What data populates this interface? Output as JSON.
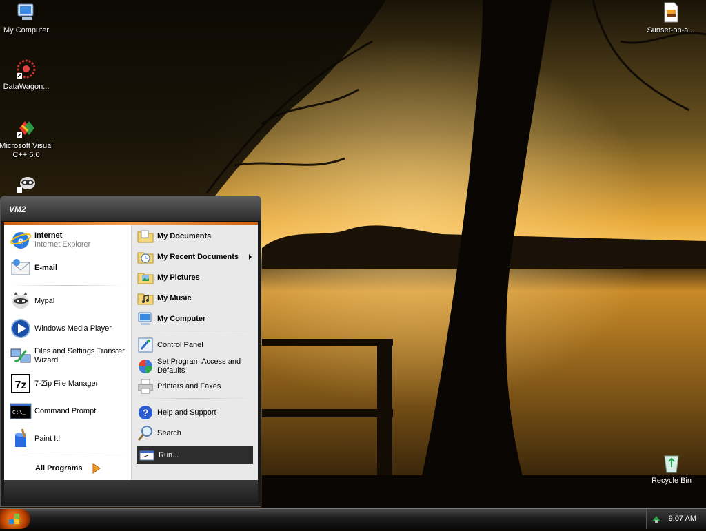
{
  "desktop": {
    "icons": [
      {
        "label": "My Computer"
      },
      {
        "label": "DataWagon..."
      },
      {
        "label": "Microsoft Visual C++ 6.0"
      },
      {
        "label": ""
      },
      {
        "label": "Sunset-on-a..."
      },
      {
        "label": "Recycle Bin"
      }
    ]
  },
  "start_menu": {
    "user": "VM2",
    "pinned": [
      {
        "title": "Internet",
        "subtitle": "Internet Explorer",
        "icon": "internet-explorer-icon"
      },
      {
        "title": "E-mail",
        "icon": "email-icon"
      }
    ],
    "recent": [
      {
        "label": "Mypal",
        "icon": "mypal-icon"
      },
      {
        "label": "Windows Media Player",
        "icon": "media-player-icon"
      },
      {
        "label": "Files and Settings Transfer Wizard",
        "icon": "transfer-wizard-icon"
      },
      {
        "label": "7-Zip File Manager",
        "icon": "7zip-icon"
      },
      {
        "label": "Command Prompt",
        "icon": "command-prompt-icon"
      },
      {
        "label": "Paint It!",
        "icon": "paint-icon"
      }
    ],
    "all_programs": "All Programs",
    "places": [
      {
        "label": "My Documents",
        "icon": "folder-documents-icon"
      },
      {
        "label": "My Recent Documents",
        "icon": "recent-documents-icon"
      },
      {
        "label": "My Pictures",
        "icon": "folder-pictures-icon"
      },
      {
        "label": "My Music",
        "icon": "folder-music-icon"
      },
      {
        "label": "My Computer",
        "icon": "computer-icon"
      }
    ],
    "system": [
      {
        "label": "Control Panel",
        "icon": "control-panel-icon"
      },
      {
        "label": "Set Program Access and Defaults",
        "icon": "program-access-icon"
      },
      {
        "label": "Printers and Faxes",
        "icon": "printer-icon"
      }
    ],
    "help": [
      {
        "label": "Help and Support",
        "icon": "help-icon"
      },
      {
        "label": "Search",
        "icon": "search-icon"
      },
      {
        "label": "Run...",
        "icon": "run-icon"
      }
    ]
  },
  "taskbar": {
    "clock": "9:07 AM"
  },
  "colors": {
    "accent_orange": "#f08a24",
    "menu_dark": "#1a1a1a",
    "highlight": "#2d2d2d"
  }
}
